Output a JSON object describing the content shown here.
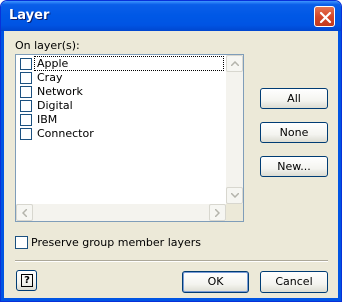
{
  "window": {
    "title": "Layer"
  },
  "label": "On layer(s):",
  "layers": [
    {
      "name": "Apple",
      "checked": false
    },
    {
      "name": "Cray",
      "checked": false
    },
    {
      "name": "Network",
      "checked": false
    },
    {
      "name": "Digital",
      "checked": false
    },
    {
      "name": "IBM",
      "checked": false
    },
    {
      "name": "Connector",
      "checked": false
    }
  ],
  "buttons": {
    "all": "All",
    "none": "None",
    "new": "New...",
    "ok": "OK",
    "cancel": "Cancel",
    "help": "?"
  },
  "preserve": {
    "label": "Preserve group member layers",
    "checked": false
  },
  "icons": {
    "close": "close-icon",
    "help": "help-icon"
  },
  "colors": {
    "titlebar": "#0054e3",
    "face": "#ece9d8",
    "close": "#d5472a"
  }
}
